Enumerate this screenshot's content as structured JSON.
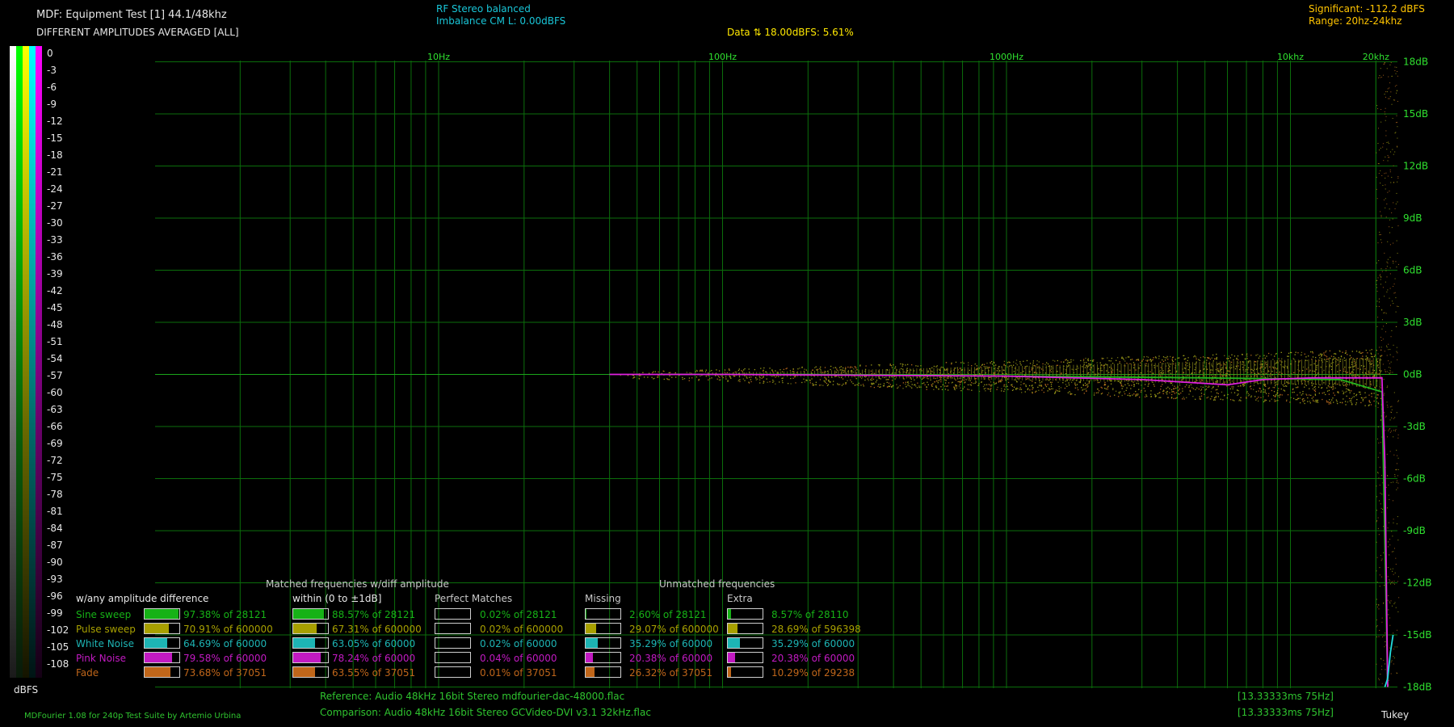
{
  "header": {
    "title": "MDF: Equipment Test [1] 44.1/48khz",
    "subtitle": "DIFFERENT AMPLITUDES AVERAGED [ALL]",
    "rf_line1": "RF Stereo balanced",
    "rf_line2": "Imbalance CM L: 0.00dBFS",
    "data_line": "Data ⇅ 18.00dBFS: 5.61%",
    "significant": "Significant: -112.2 dBFS",
    "range": "Range: 20hz-24khz"
  },
  "colors": {
    "sine": "#16b216",
    "pulse": "#a8a000",
    "white_noise": "#1db4b4",
    "pink_noise": "#c21ac2",
    "fade": "#c0661a",
    "grid": "#0b6e0b",
    "axis_text": "#2fe02f",
    "header_cyan": "#19c6d8",
    "header_yellow": "#ffe800"
  },
  "amplitude_scale": {
    "labels": [
      "0",
      "-3",
      "-6",
      "-9",
      "-12",
      "-15",
      "-18",
      "-21",
      "-24",
      "-27",
      "-30",
      "-33",
      "-36",
      "-39",
      "-42",
      "-45",
      "-48",
      "-51",
      "-54",
      "-57",
      "-60",
      "-63",
      "-66",
      "-69",
      "-72",
      "-75",
      "-78",
      "-81",
      "-84",
      "-87",
      "-90",
      "-93",
      "-96",
      "-99",
      "-102",
      "-105",
      "-108"
    ],
    "unit": "dBFS"
  },
  "chart_data": {
    "type": "scatter",
    "x_scale": "log",
    "x_ticks": [
      {
        "label": "10Hz",
        "value": 10
      },
      {
        "label": "100Hz",
        "value": 100
      },
      {
        "label": "1000Hz",
        "value": 1000
      },
      {
        "label": "10khz",
        "value": 10000
      },
      {
        "label": "20khz",
        "value": 20000
      }
    ],
    "y_ticks": [
      "18dB",
      "15dB",
      "12dB",
      "9dB",
      "6dB",
      "3dB",
      "0dB",
      "-3dB",
      "-6dB",
      "-9dB",
      "-12dB",
      "-15dB",
      "-18dB"
    ],
    "ylim": [
      -18,
      18
    ],
    "grid": true,
    "series": [
      {
        "name": "Sine sweep",
        "x": [
          60,
          200,
          1000,
          5000,
          15000,
          21000,
          22000
        ],
        "y": [
          0.0,
          0.0,
          -0.1,
          -0.2,
          -0.3,
          -1.0,
          -18
        ]
      },
      {
        "name": "Pink Noise",
        "x": [
          40,
          100,
          1000,
          3000,
          6000,
          8000,
          12000,
          16000,
          21000,
          21500,
          22000
        ],
        "y": [
          0.0,
          0.0,
          -0.1,
          -0.3,
          -0.6,
          -0.3,
          -0.2,
          -0.2,
          -0.2,
          -5.0,
          -18
        ]
      },
      {
        "name": "White Noise",
        "x": [
          21500,
          22000,
          22500,
          23000
        ],
        "y": [
          -18,
          -17.5,
          -16,
          -15
        ]
      }
    ]
  },
  "stats": {
    "section_matched": "Matched frequencies w/diff amplitude",
    "section_unmatched": "Unmatched frequencies",
    "headers": {
      "any": "w/any amplitude difference",
      "within": "within (0 to ±1dB]",
      "perfect": "Perfect Matches",
      "missing": "Missing",
      "extra": "Extra"
    },
    "rows": [
      {
        "name": "Sine sweep",
        "color_key": "sine",
        "any": "97.38% of 28121",
        "any_pct": 97.38,
        "within": "88.57% of 28121",
        "within_pct": 88.57,
        "perfect": "0.02% of 28121",
        "perfect_pct": 0.02,
        "missing": "2.60% of 28121",
        "missing_pct": 2.6,
        "extra": "8.57% of 28110",
        "extra_pct": 8.57
      },
      {
        "name": "Pulse sweep",
        "color_key": "pulse",
        "any": "70.91% of 600000",
        "any_pct": 70.91,
        "within": "67.31% of 600000",
        "within_pct": 67.31,
        "perfect": "0.02% of 600000",
        "perfect_pct": 0.02,
        "missing": "29.07% of 600000",
        "missing_pct": 29.07,
        "extra": "28.69% of 596398",
        "extra_pct": 28.69
      },
      {
        "name": "White Noise",
        "color_key": "white_noise",
        "any": "64.69% of 60000",
        "any_pct": 64.69,
        "within": "63.05% of 60000",
        "within_pct": 63.05,
        "perfect": "0.02% of 60000",
        "perfect_pct": 0.02,
        "missing": "35.29% of 60000",
        "missing_pct": 35.29,
        "extra": "35.29% of 60000",
        "extra_pct": 35.29
      },
      {
        "name": "Pink Noise",
        "color_key": "pink_noise",
        "any": "79.58% of 60000",
        "any_pct": 79.58,
        "within": "78.24% of 60000",
        "within_pct": 78.24,
        "perfect": "0.04% of 60000",
        "perfect_pct": 0.04,
        "missing": "20.38% of 60000",
        "missing_pct": 20.38,
        "extra": "20.38% of 60000",
        "extra_pct": 20.38
      },
      {
        "name": "Fade",
        "color_key": "fade",
        "any": "73.68% of 37051",
        "any_pct": 73.68,
        "within": "63.55% of 37051",
        "within_pct": 63.55,
        "perfect": "0.01% of 37051",
        "perfect_pct": 0.01,
        "missing": "26.32% of 37051",
        "missing_pct": 26.32,
        "extra": "10.29% of 29238",
        "extra_pct": 10.29
      }
    ]
  },
  "footer": {
    "reference": "Reference:   Audio    48kHz 16bit Stereo mdfourier-dac-48000.flac",
    "comparison": "Comparison:  Audio    48kHz 16bit Stereo GCVideo-DVI v3.1 32kHz.flac",
    "credits": "MDFourier 1.08 for 240p Test Suite by Artemio Urbina",
    "timing1": "[13.33333ms 75Hz]",
    "timing2": "[13.33333ms 75Hz]",
    "window": "Tukey"
  }
}
